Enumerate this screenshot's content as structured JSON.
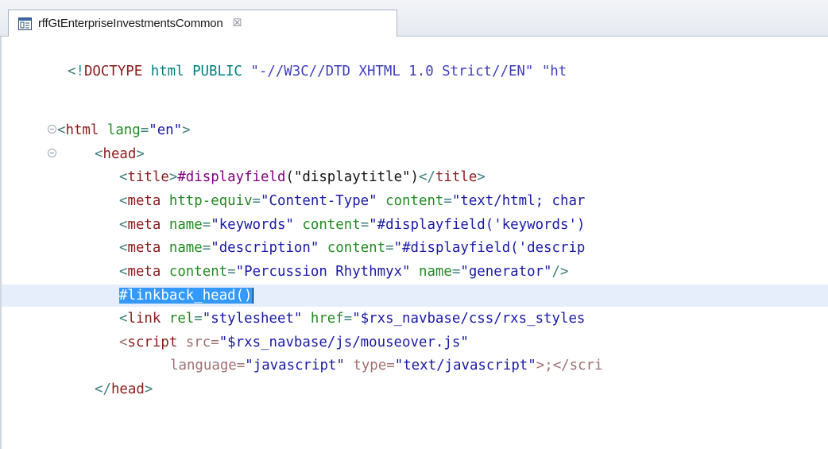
{
  "editor_tab": {
    "title": "rffGtEnterpriseInvestmentsCommon",
    "close_glyph": "☒",
    "icon": "template-editor-icon"
  },
  "code": {
    "line1": {
      "a": "<!",
      "b": "DOCTYPE",
      "c": " html PUBLIC ",
      "d": "\"-//W3C//DTD XHTML 1.0 Strict//EN\"",
      "e": " \"ht"
    },
    "line3": {
      "a": "<",
      "b": "html",
      "c": " lang",
      "d": "=",
      "e": "\"en\"",
      "f": ">"
    },
    "line4": {
      "a": "<",
      "b": "head",
      "c": ">"
    },
    "line5": {
      "a": "<",
      "b": "title",
      "c": ">",
      "d": "#displayfield",
      "e": "(\"displaytitle\")",
      "f": "</",
      "g": "title",
      "h": ">"
    },
    "line6": {
      "a": "<",
      "b": "meta",
      "c": " http-equiv",
      "d": "=",
      "e": "\"Content-Type\"",
      "f": " content",
      "g": "=",
      "h": "\"text/html; char"
    },
    "line7": {
      "a": "<",
      "b": "meta",
      "c": " name",
      "d": "=",
      "e": "\"keywords\"",
      "f": " content",
      "g": "=",
      "h": "\"#displayfield('keywords')"
    },
    "line8": {
      "a": "<",
      "b": "meta",
      "c": " name",
      "d": "=",
      "e": "\"description\"",
      "f": " content",
      "g": "=",
      "h": "\"#displayfield('descrip"
    },
    "line9": {
      "a": "<",
      "b": "meta",
      "c": " content",
      "d": "=",
      "e": "\"Percussion Rhythmyx\"",
      "f": " name",
      "g": "=",
      "h": "\"generator\"",
      "i": "/>"
    },
    "line10": {
      "sel": "#linkback_head()"
    },
    "line11": {
      "a": "<",
      "b": "link",
      "c": " rel",
      "d": "=",
      "e": "\"stylesheet\"",
      "f": " href",
      "g": "=",
      "h": "\"$rxs_navbase/css/rxs_styles"
    },
    "line12": {
      "a": "<",
      "b": "script",
      "c": " src",
      "d": "=",
      "e": "\"$rxs_navbase/js/mouseover.js\""
    },
    "line13": {
      "a": "language",
      "b": "=",
      "c": "\"javascript\"",
      "d": " type",
      "e": "=",
      "f": "\"text/javascript\"",
      "g": ">;",
      "h": "</scri"
    },
    "line14": {
      "a": "</",
      "b": "head",
      "c": ">"
    }
  }
}
